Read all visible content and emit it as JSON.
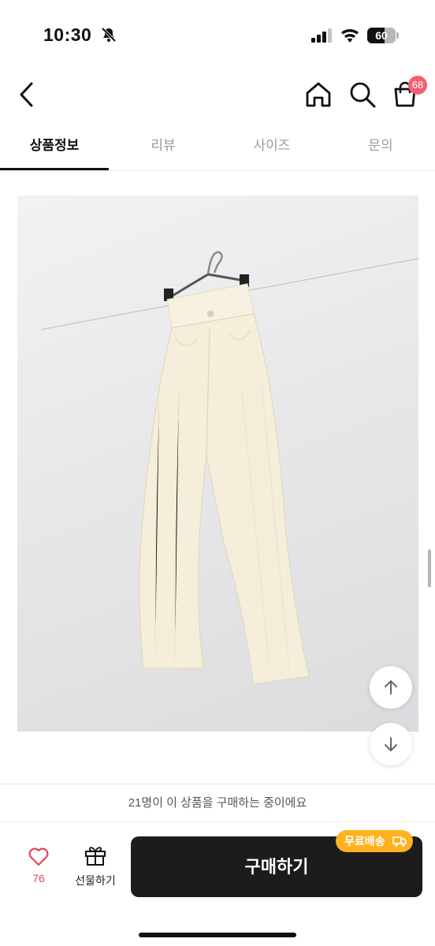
{
  "status_bar": {
    "time": "10:30",
    "battery_level": "60",
    "battery_fraction": 0.6
  },
  "header": {
    "cart_badge_count": "68"
  },
  "tabs": [
    {
      "label": "상품정보",
      "active": true
    },
    {
      "label": "리뷰",
      "active": false
    },
    {
      "label": "사이즈",
      "active": false
    },
    {
      "label": "문의",
      "active": false
    }
  ],
  "product": {
    "image_icon": "cream-corduroy-pants-on-hanger"
  },
  "footer": {
    "buyer_notice": "21명이 이 상품을 구매하는 중이에요",
    "like_count": "76",
    "gift_label": "선물하기",
    "buy_label": "구매하기",
    "shipping_badge": "무료배송"
  },
  "colors": {
    "accent_red": "#f46070",
    "like_red": "#e2465b",
    "shipping_orange": "#ffb11f",
    "buy_button": "#1c1c1c"
  }
}
